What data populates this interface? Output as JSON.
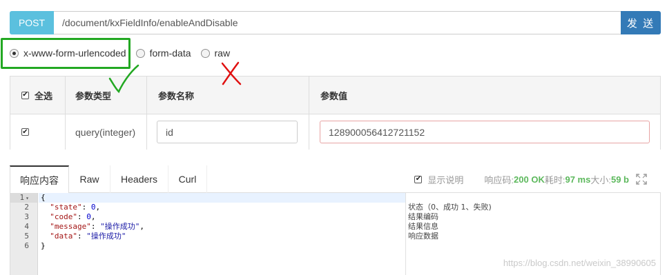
{
  "request": {
    "method": "POST",
    "url": "/document/kxFieldInfo/enableAndDisable",
    "send_label": "发 送"
  },
  "content_types": [
    {
      "label": "x-www-form-urlencoded",
      "selected": true
    },
    {
      "label": "form-data",
      "selected": false
    },
    {
      "label": "raw",
      "selected": false
    }
  ],
  "params_table": {
    "headers": {
      "select_all": "全选",
      "type": "参数类型",
      "name": "参数名称",
      "value": "参数值"
    },
    "rows": [
      {
        "checked": true,
        "type": "query(integer)",
        "name": "id",
        "value": "128900056412721152"
      }
    ]
  },
  "response": {
    "tabs": [
      "响应内容",
      "Raw",
      "Headers",
      "Curl"
    ],
    "active_tab": "响应内容",
    "show_desc_label": "显示说明",
    "code_label": "响应码:",
    "code_value": "200 OK",
    "time_label": "耗时:",
    "time_value": "97 ms",
    "size_label": "大小:",
    "size_value": "59 b"
  },
  "editor": {
    "line_numbers": [
      "1",
      "2",
      "3",
      "4",
      "5",
      "6"
    ],
    "lines": [
      {
        "key": "",
        "text": "{"
      },
      {
        "key": "state",
        "value": "0",
        "kind": "num"
      },
      {
        "key": "code",
        "value": "0",
        "kind": "num"
      },
      {
        "key": "message",
        "value": "\"操作成功\"",
        "kind": "str"
      },
      {
        "key": "data",
        "value": "\"操作成功\"",
        "kind": "str"
      },
      {
        "key": "",
        "text": "}"
      }
    ],
    "descriptions": [
      "",
      "状态（0、成功 1、失败)",
      "结果编码",
      "结果信息",
      "响应数据",
      ""
    ]
  },
  "watermark": "https://blog.csdn.net/weixin_38990605",
  "colors": {
    "method_bg": "#5bc0de",
    "send_bg": "#337ab7",
    "annotation_green": "#22a822",
    "annotation_red": "#e01010",
    "success_green": "#5cb85c"
  }
}
